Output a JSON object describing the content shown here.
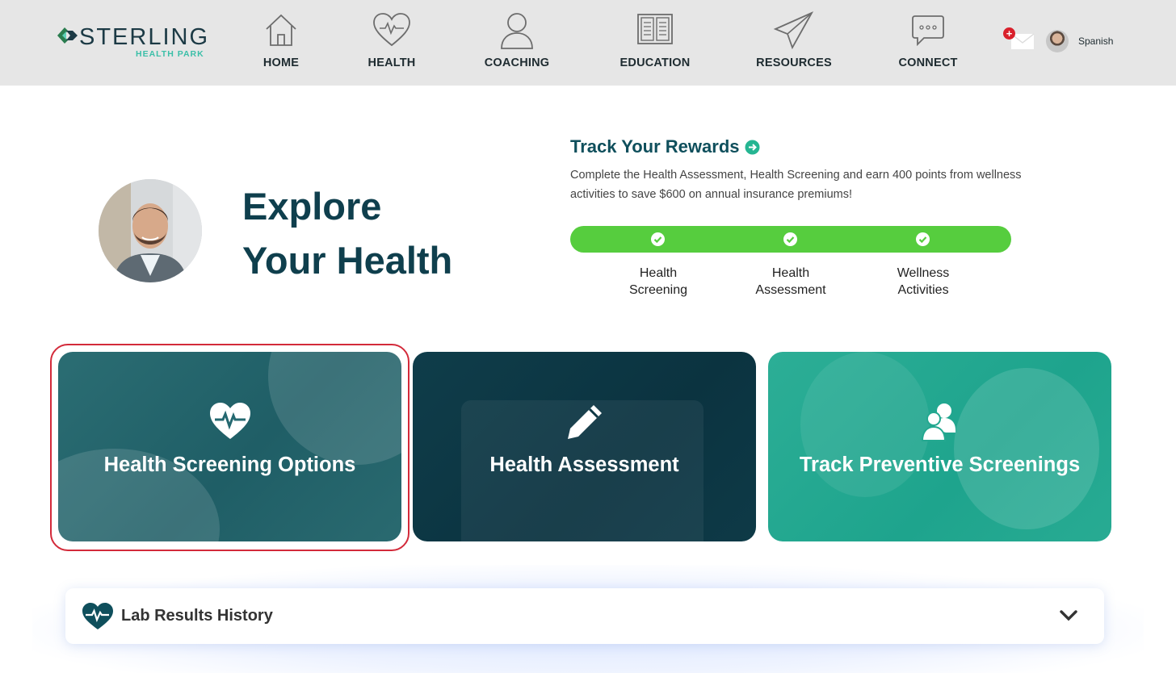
{
  "brand": {
    "name": "STERLING",
    "sub": "HEALTH PARK"
  },
  "nav": [
    {
      "label": "HOME",
      "icon": "home-icon"
    },
    {
      "label": "HEALTH",
      "icon": "heart-pulse-icon"
    },
    {
      "label": "COACHING",
      "icon": "person-icon"
    },
    {
      "label": "EDUCATION",
      "icon": "book-icon"
    },
    {
      "label": "RESOURCES",
      "icon": "paper-plane-icon"
    },
    {
      "label": "CONNECT",
      "icon": "chat-icon"
    }
  ],
  "header": {
    "language": "Spanish",
    "mail_badge": "+"
  },
  "hero": {
    "title_line1": "Explore",
    "title_line2": "Your Health"
  },
  "rewards": {
    "title": "Track Your Rewards",
    "description": "Complete the Health Assessment, Health Screening and earn 400 points from wellness activities to save $600 on annual insurance premiums!",
    "steps": [
      {
        "line1": "Health",
        "line2": "Screening",
        "completed": true
      },
      {
        "line1": "Health",
        "line2": "Assessment",
        "completed": true
      },
      {
        "line1": "Wellness",
        "line2": "Activities",
        "completed": true
      }
    ],
    "progress_fraction": 1.0,
    "progress_color": "#56cd3e"
  },
  "cards": [
    {
      "label": "Health Screening Options",
      "icon": "heart-pulse-icon",
      "color": "#246870",
      "highlighted": true
    },
    {
      "label": "Health Assessment",
      "icon": "pencil-icon",
      "color": "#0d3744"
    },
    {
      "label": "Track Preventive Screenings",
      "icon": "users-icon",
      "color": "#24a890"
    }
  ],
  "accordion": {
    "title": "Lab Results History",
    "icon": "heart-pulse-icon",
    "expanded": false
  },
  "colors": {
    "accent_teal": "#0f4f5c",
    "header_bg": "#e6e6e6",
    "highlight_border": "#d32a3a"
  }
}
